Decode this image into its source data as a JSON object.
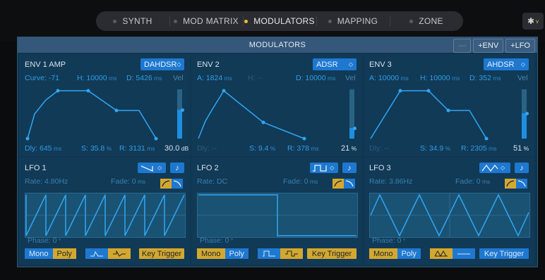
{
  "tabs": [
    {
      "label": "SYNTH",
      "active": false
    },
    {
      "label": "MOD MATRIX",
      "active": false
    },
    {
      "label": "MODULATORS",
      "active": true
    },
    {
      "label": "MAPPING",
      "active": false
    },
    {
      "label": "ZONE",
      "active": false
    }
  ],
  "settings": {
    "icon": "gear-icon",
    "chevron": "v"
  },
  "panel": {
    "title": "MODULATORS",
    "minus_label": "—",
    "add_env_label": "+ENV",
    "add_lfo_label": "+LFO"
  },
  "envs": [
    {
      "name": "ENV 1 AMP",
      "type": "DAHDSR",
      "type_arrow": "◇",
      "top_params": [
        {
          "label": "Curve: -71",
          "unit": "",
          "dim": false
        },
        {
          "label": "H: 10000",
          "unit": " ms",
          "dim": false
        },
        {
          "label": "D: 5426",
          "unit": " ms",
          "dim": false
        }
      ],
      "vel_label": "Vel",
      "bottom_params": [
        {
          "label": "Dly: 645",
          "unit": " ms",
          "dim": false
        },
        {
          "label": "S: 35.8",
          "unit": " %",
          "dim": false
        },
        {
          "label": "R: 3131",
          "unit": " ms",
          "dim": false
        }
      ],
      "vel_value": "30.0",
      "vel_unit": " dB",
      "vel_level": 0.58
    },
    {
      "name": "ENV 2",
      "type": "ADSR",
      "type_arrow": "◇",
      "top_params": [
        {
          "label": "A: 1824",
          "unit": " ms",
          "dim": false
        },
        {
          "label": "H: --",
          "unit": "",
          "dim": true
        },
        {
          "label": "D: 10000",
          "unit": " ms",
          "dim": false
        }
      ],
      "vel_label": "Vel",
      "bottom_params": [
        {
          "label": "Dly: --",
          "unit": "",
          "dim": true
        },
        {
          "label": "S: 9.4",
          "unit": " %",
          "dim": false
        },
        {
          "label": "R: 378",
          "unit": " ms",
          "dim": false
        }
      ],
      "vel_value": "21",
      "vel_unit": " %",
      "vel_level": 0.21
    },
    {
      "name": "ENV 3",
      "type": "AHDSR",
      "type_arrow": "◇",
      "top_params": [
        {
          "label": "A: 10000",
          "unit": " ms",
          "dim": false
        },
        {
          "label": "H: 10000",
          "unit": " ms",
          "dim": false
        },
        {
          "label": "D: 352",
          "unit": " ms",
          "dim": false
        }
      ],
      "vel_label": "Vel",
      "bottom_params": [
        {
          "label": "Dly: --",
          "unit": "",
          "dim": true
        },
        {
          "label": "S: 34.9",
          "unit": " %",
          "dim": false
        },
        {
          "label": "R: 2305",
          "unit": " ms",
          "dim": false
        }
      ],
      "vel_value": "51",
      "vel_unit": " %",
      "vel_level": 0.51
    }
  ],
  "lfos": [
    {
      "name": "LFO 1",
      "waveform": "sawtooth",
      "rate": "Rate: 4.80Hz",
      "fade": "Fade: 0",
      "fade_unit": " ms",
      "phase": "Phase: 0",
      "phase_unit": " °",
      "mono_label": "Mono",
      "poly_label": "Poly",
      "mode": "poly",
      "key_trigger_label": "Key Trigger",
      "key_trigger_on": true,
      "note_icon": "note-icon"
    },
    {
      "name": "LFO 2",
      "waveform": "square",
      "rate": "Rate: DC",
      "fade": "Fade: 0",
      "fade_unit": " ms",
      "phase": "Phase: 0",
      "phase_unit": " °",
      "mono_label": "Mono",
      "poly_label": "Poly",
      "mode": "mono",
      "key_trigger_label": "Key Trigger",
      "key_trigger_on": true,
      "note_icon": "note-icon"
    },
    {
      "name": "LFO 3",
      "waveform": "triangle",
      "rate": "Rate: 3.86Hz",
      "fade": "Fade: 0",
      "fade_unit": " ms",
      "phase": "Phase: 0",
      "phase_unit": " °",
      "mono_label": "Mono",
      "poly_label": "Poly",
      "mode": "mono",
      "key_trigger_label": "Key Trigger",
      "key_trigger_on": false,
      "note_icon": "note-icon"
    }
  ],
  "colors": {
    "accent": "#1e78d0",
    "active": "#d4a82e",
    "curve": "#2fa6f2",
    "panel": "#113a57"
  }
}
